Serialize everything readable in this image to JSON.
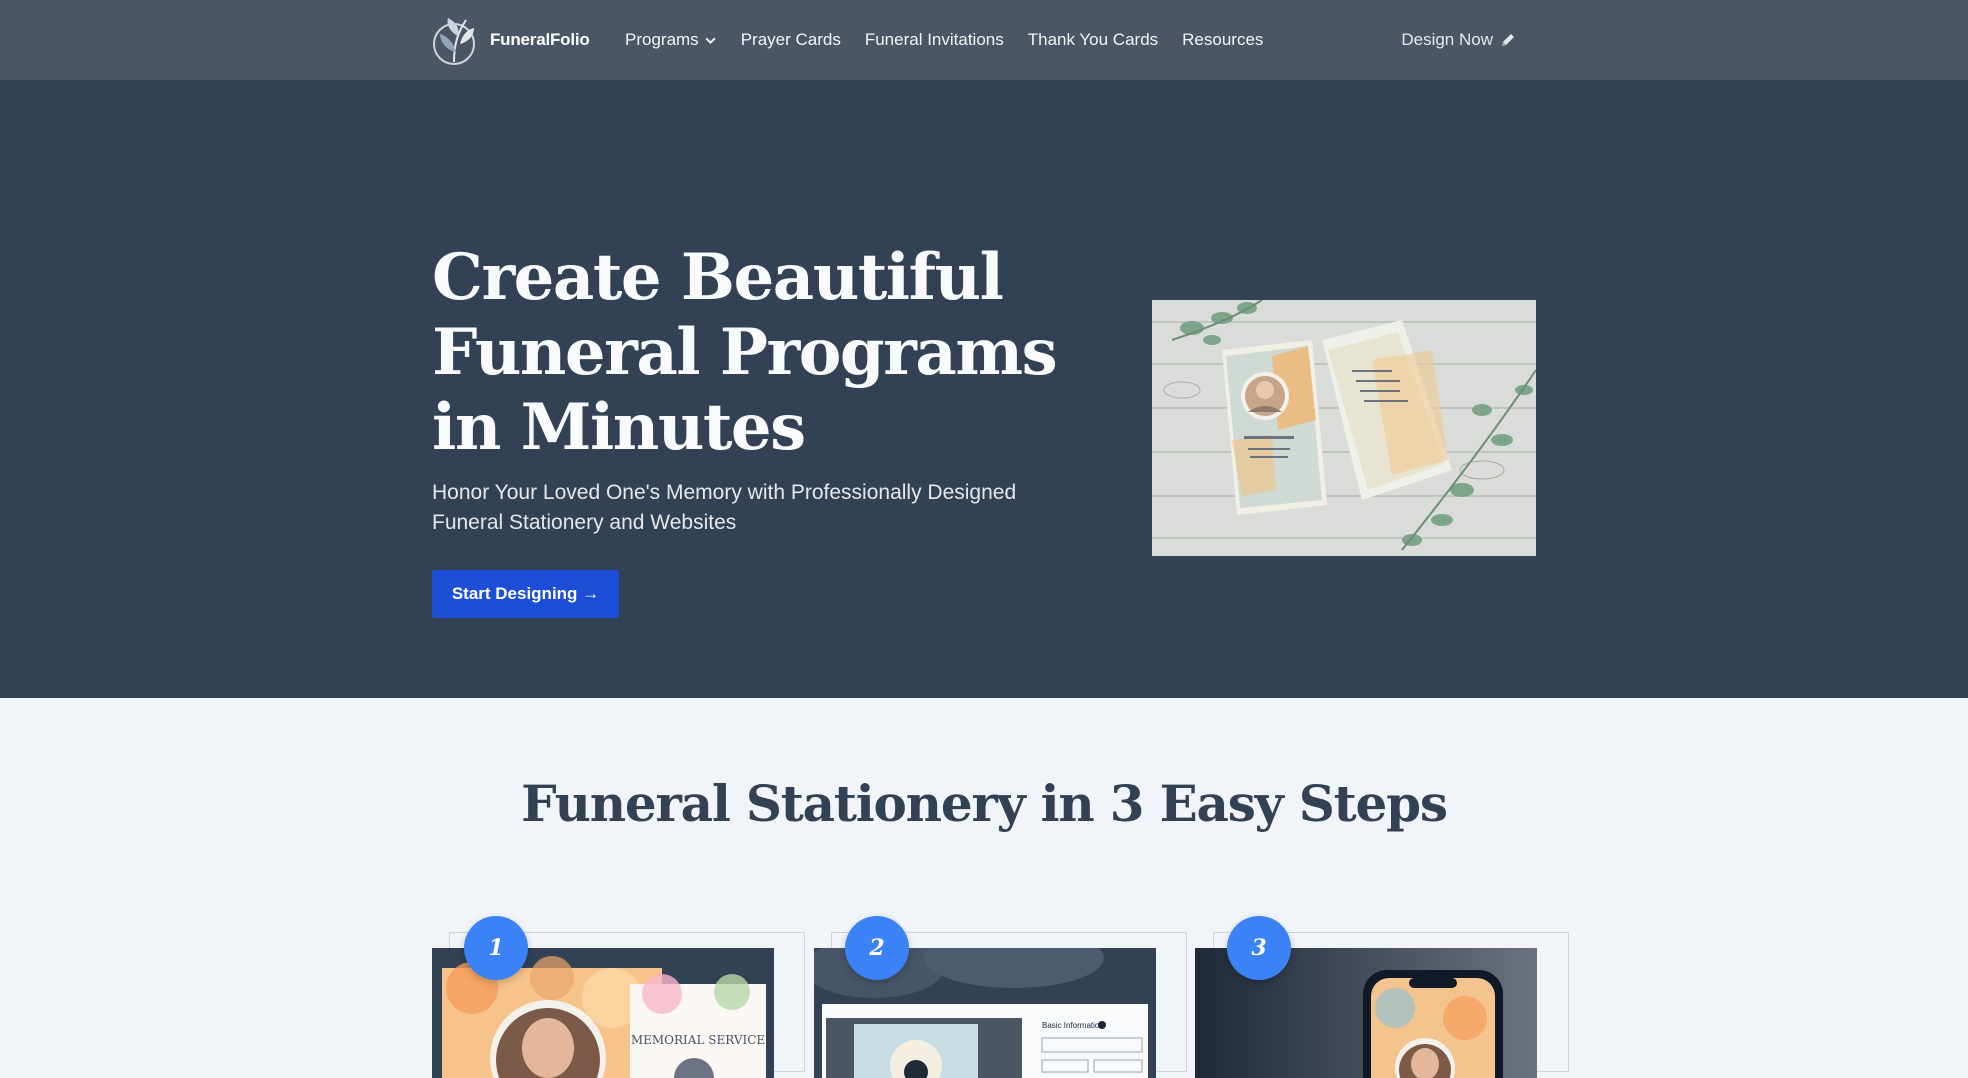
{
  "nav": {
    "brand": "FuneralFolio",
    "items": [
      {
        "label": "Programs",
        "has_dropdown": true
      },
      {
        "label": "Prayer Cards"
      },
      {
        "label": "Funeral Invitations"
      },
      {
        "label": "Thank You Cards"
      },
      {
        "label": "Resources"
      }
    ],
    "design_now": "Design Now"
  },
  "hero": {
    "title": "Create Beautiful Funeral Programs in Minutes",
    "subtitle": "Honor Your Loved One's Memory with Professionally Designed Funeral Stationery and Websites",
    "cta": "Start Designing →"
  },
  "steps": {
    "title": "Funeral Stationery in 3 Easy Steps",
    "items": [
      {
        "number": "1",
        "image_text": "MEMORIAL SERVICE"
      },
      {
        "number": "2",
        "image_text": "Basic Information"
      },
      {
        "number": "3"
      }
    ]
  },
  "colors": {
    "nav_bg": "#4b5563",
    "hero_bg": "#334155",
    "accent": "#1d4ed8",
    "badge": "#3b82f6",
    "page_bg": "#f1f4f9"
  }
}
